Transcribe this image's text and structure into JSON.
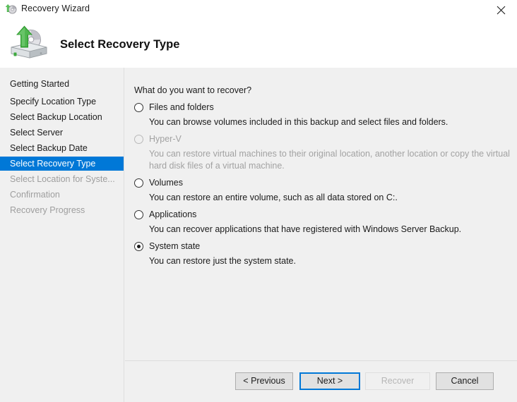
{
  "window": {
    "title": "Recovery Wizard",
    "title_icon": "recovery-disk-icon",
    "close_icon": "close-icon",
    "accent_color": "#0078d7",
    "body_background": "#f0f0f0",
    "disabled_text_color": "#a2a2a2"
  },
  "header": {
    "heading": "Select Recovery Type",
    "icon": "hard-disk-restore-icon"
  },
  "sidebar": {
    "items": [
      {
        "label": "Getting Started",
        "state": "normal"
      },
      {
        "label": "Specify Location Type",
        "state": "normal"
      },
      {
        "label": "Select Backup Location",
        "state": "normal"
      },
      {
        "label": "Select Server",
        "state": "normal"
      },
      {
        "label": "Select Backup Date",
        "state": "normal"
      },
      {
        "label": "Select Recovery Type",
        "state": "active"
      },
      {
        "label": "Select Location for Syste...",
        "state": "disabled"
      },
      {
        "label": "Confirmation",
        "state": "disabled"
      },
      {
        "label": "Recovery Progress",
        "state": "disabled"
      }
    ]
  },
  "main": {
    "question": "What do you want to recover?",
    "options": [
      {
        "label": "Files and folders",
        "description": "You can browse volumes included in this backup and select files and folders.",
        "checked": false,
        "disabled": false
      },
      {
        "label": "Hyper-V",
        "description": "You can restore virtual machines to their original location, another location or copy the virtual hard disk files of a virtual machine.",
        "checked": false,
        "disabled": true
      },
      {
        "label": "Volumes",
        "description": "You can restore an entire volume, such as all data stored on C:.",
        "checked": false,
        "disabled": false
      },
      {
        "label": "Applications",
        "description": "You can recover applications that have registered with Windows Server Backup.",
        "checked": false,
        "disabled": false
      },
      {
        "label": "System state",
        "description": "You can restore just the system state.",
        "checked": true,
        "disabled": false
      }
    ]
  },
  "footer": {
    "previous_label": "< Previous",
    "next_label": "Next >",
    "recover_label": "Recover",
    "cancel_label": "Cancel"
  }
}
